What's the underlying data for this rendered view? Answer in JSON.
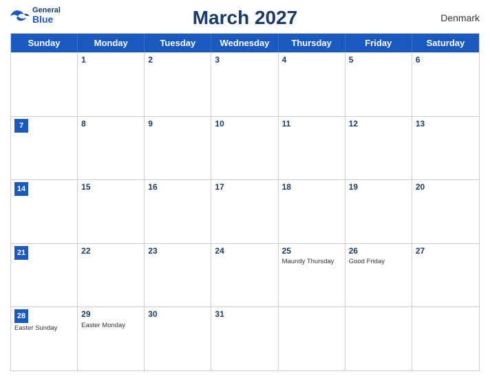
{
  "header": {
    "title": "March 2027",
    "country": "Denmark",
    "logo": {
      "general": "General",
      "blue": "Blue"
    }
  },
  "dayHeaders": [
    "Sunday",
    "Monday",
    "Tuesday",
    "Wednesday",
    "Thursday",
    "Friday",
    "Saturday"
  ],
  "weeks": [
    [
      {
        "date": "",
        "events": []
      },
      {
        "date": "1",
        "events": []
      },
      {
        "date": "2",
        "events": []
      },
      {
        "date": "3",
        "events": []
      },
      {
        "date": "4",
        "events": []
      },
      {
        "date": "5",
        "events": []
      },
      {
        "date": "6",
        "events": []
      }
    ],
    [
      {
        "date": "7",
        "events": [],
        "sunday": true
      },
      {
        "date": "8",
        "events": []
      },
      {
        "date": "9",
        "events": []
      },
      {
        "date": "10",
        "events": []
      },
      {
        "date": "11",
        "events": []
      },
      {
        "date": "12",
        "events": []
      },
      {
        "date": "13",
        "events": []
      }
    ],
    [
      {
        "date": "14",
        "events": [],
        "sunday": true
      },
      {
        "date": "15",
        "events": []
      },
      {
        "date": "16",
        "events": []
      },
      {
        "date": "17",
        "events": []
      },
      {
        "date": "18",
        "events": []
      },
      {
        "date": "19",
        "events": []
      },
      {
        "date": "20",
        "events": []
      }
    ],
    [
      {
        "date": "21",
        "events": [],
        "sunday": true
      },
      {
        "date": "22",
        "events": []
      },
      {
        "date": "23",
        "events": []
      },
      {
        "date": "24",
        "events": []
      },
      {
        "date": "25",
        "events": [
          "Maundy Thursday"
        ]
      },
      {
        "date": "26",
        "events": [
          "Good Friday"
        ]
      },
      {
        "date": "27",
        "events": []
      }
    ],
    [
      {
        "date": "28",
        "events": [
          "Easter Sunday"
        ],
        "sunday": true
      },
      {
        "date": "29",
        "events": [
          "Easter Monday"
        ]
      },
      {
        "date": "30",
        "events": []
      },
      {
        "date": "31",
        "events": []
      },
      {
        "date": "",
        "events": []
      },
      {
        "date": "",
        "events": []
      },
      {
        "date": "",
        "events": []
      }
    ]
  ]
}
